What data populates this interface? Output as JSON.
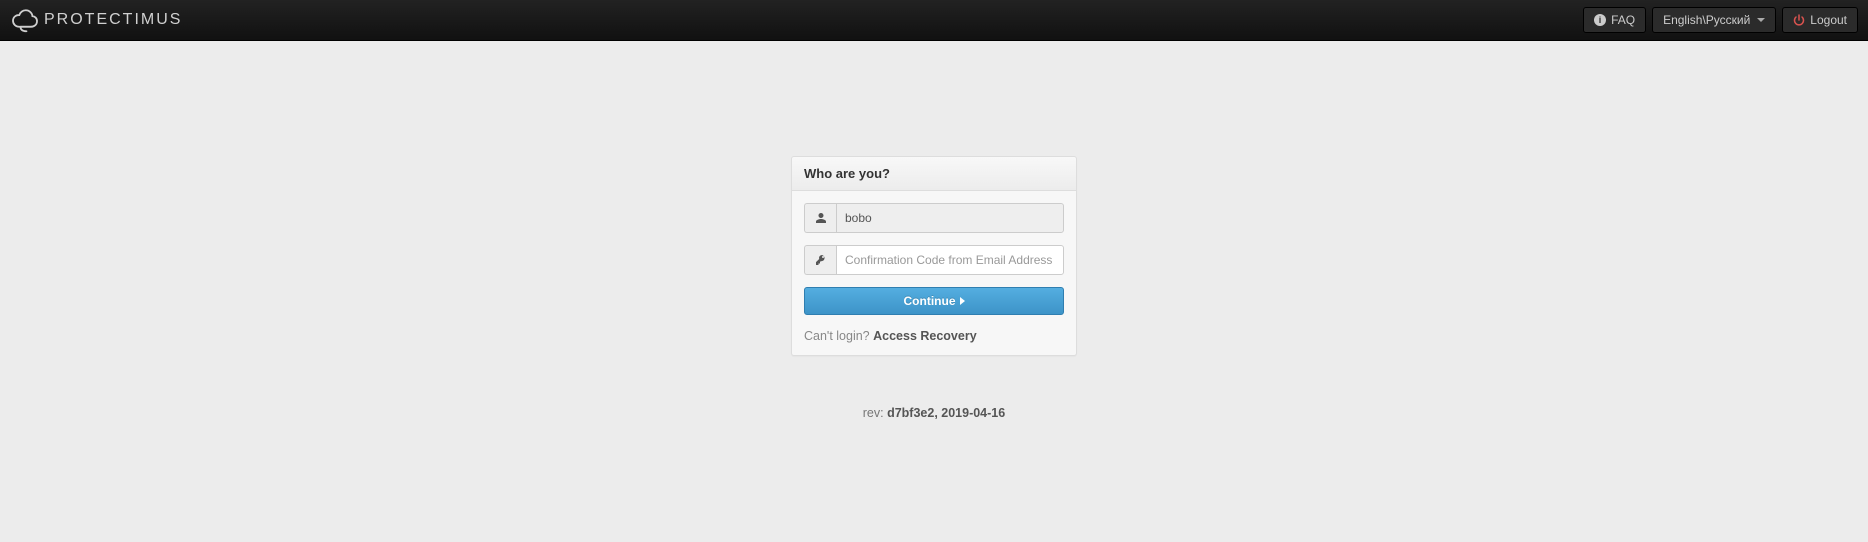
{
  "brand": "PROTECTIMUS",
  "nav": {
    "faq": "FAQ",
    "language": "English\\Русский",
    "logout": "Logout"
  },
  "panel": {
    "title": "Who are you?",
    "username_value": "bobo",
    "code_placeholder": "Confirmation Code from Email Address",
    "continue_label": "Continue",
    "cant_login": "Can't login? ",
    "recovery_link": "Access Recovery"
  },
  "footer": {
    "prefix": "rev: ",
    "value": "d7bf3e2, 2019-04-16"
  }
}
